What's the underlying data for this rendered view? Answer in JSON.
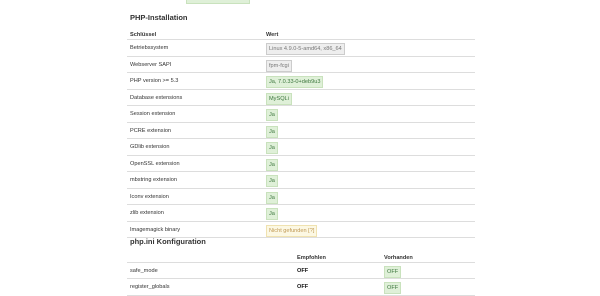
{
  "php_installation": {
    "title": "PHP-Installation",
    "headers": {
      "key": "Schlüssel",
      "value": "Wert"
    },
    "rows": [
      {
        "key": "Betriebssystem",
        "value": "Linux 4.9.0-5-amd64, x86_64",
        "status": "default"
      },
      {
        "key": "Webserver SAPI",
        "value": "fpm-fcgi",
        "status": "default"
      },
      {
        "key": "PHP version >= 5.3",
        "value": "Ja, 7.0.33-0+deb9u3",
        "status": "success"
      },
      {
        "key": "Database extensions",
        "value": "MySQLi",
        "status": "success"
      },
      {
        "key": "Session extension",
        "value": "Ja",
        "status": "success"
      },
      {
        "key": "PCRE extension",
        "value": "Ja",
        "status": "success"
      },
      {
        "key": "GDlib extension",
        "value": "Ja",
        "status": "success"
      },
      {
        "key": "OpenSSL extension",
        "value": "Ja",
        "status": "success"
      },
      {
        "key": "mbstring extension",
        "value": "Ja",
        "status": "success"
      },
      {
        "key": "Iconv extension",
        "value": "Ja",
        "status": "success"
      },
      {
        "key": "zlib extension",
        "value": "Ja",
        "status": "success"
      },
      {
        "key": "Imagemagick binary",
        "value": "Nicht gefunden [?]",
        "status": "warning"
      }
    ]
  },
  "php_ini": {
    "title": "php.ini Konfiguration",
    "headers": {
      "recommended": "Empfohlen",
      "present": "Vorhanden"
    },
    "rows": [
      {
        "key": "safe_mode",
        "recommended": "OFF",
        "present": "OFF"
      },
      {
        "key": "register_globals",
        "recommended": "OFF",
        "present": "OFF"
      }
    ]
  }
}
